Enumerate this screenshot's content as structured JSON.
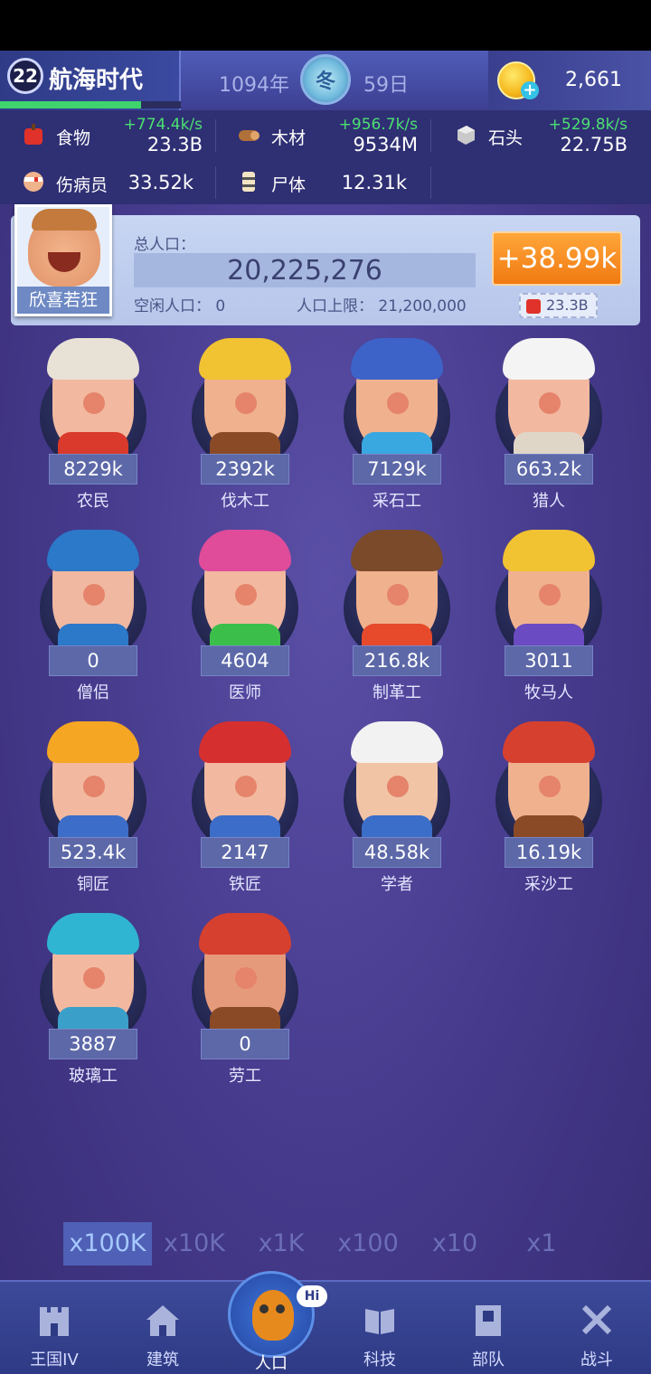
{
  "header": {
    "era_name": "航海时代",
    "era_logo_text": "22",
    "year": "1094年",
    "season": "冬",
    "day": "59日",
    "gold": "2,661"
  },
  "resources": {
    "food": {
      "label": "食物",
      "rate": "+774.4k/s",
      "amount": "23.3B"
    },
    "wood": {
      "label": "木材",
      "rate": "+956.7k/s",
      "amount": "9534M"
    },
    "stone": {
      "label": "石头",
      "rate": "+529.8k/s",
      "amount": "22.75B"
    },
    "wounded": {
      "label": "伤病员",
      "amount": "33.52k"
    },
    "corpses": {
      "label": "尸体",
      "amount": "12.31k"
    }
  },
  "population": {
    "leader_name": "欣喜若狂",
    "total_label": "总人口：",
    "total": "20,225,276",
    "idle": "空闲人口： 0",
    "limit": "人口上限： 21,200,000",
    "growth": "+38.99k",
    "food_cost": "23.3B"
  },
  "units": [
    {
      "name": "农民",
      "count": "8229k"
    },
    {
      "name": "伐木工",
      "count": "2392k"
    },
    {
      "name": "采石工",
      "count": "7129k"
    },
    {
      "name": "猎人",
      "count": "663.2k"
    },
    {
      "name": "僧侣",
      "count": "0"
    },
    {
      "name": "医师",
      "count": "4604"
    },
    {
      "name": "制革工",
      "count": "216.8k"
    },
    {
      "name": "牧马人",
      "count": "3011"
    },
    {
      "name": "铜匠",
      "count": "523.4k"
    },
    {
      "name": "铁匠",
      "count": "2147"
    },
    {
      "name": "学者",
      "count": "48.58k"
    },
    {
      "name": "采沙工",
      "count": "16.19k"
    },
    {
      "name": "玻璃工",
      "count": "3887"
    },
    {
      "name": "劳工",
      "count": "0"
    }
  ],
  "multipliers": [
    "x100K",
    "x10K",
    "x1K",
    "x100",
    "x10",
    "x1"
  ],
  "active_multiplier": "x100K",
  "nav": {
    "kingdom": "王国IV",
    "build": "建筑",
    "population": "人口",
    "hi": "Hi",
    "tech": "科技",
    "army": "部队",
    "battle": "战斗"
  },
  "colors": {
    "rate_green": "#4be070",
    "growth_orange": "#f07a12",
    "background_purple": "#45398b"
  }
}
